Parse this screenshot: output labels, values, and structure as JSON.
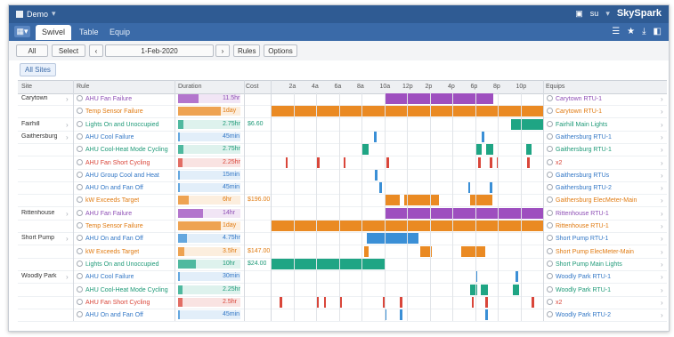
{
  "topbar": {
    "project": "Demo",
    "user": "su",
    "brand": "SkySpark"
  },
  "tabs": [
    {
      "label": "Swivel",
      "active": true
    },
    {
      "label": "Table",
      "active": false
    },
    {
      "label": "Equip",
      "active": false
    }
  ],
  "toolbar": {
    "all_sites": "All Sites",
    "select": "Select ▾",
    "prev": "‹",
    "date": "1-Feb-2020",
    "next": "›",
    "rules": "Rules",
    "options": "Options"
  },
  "filter_chip": "All Sites",
  "columns": {
    "site": "Site",
    "rule": "Rule",
    "duration": "Duration",
    "cost": "Cost",
    "equips": "Equips"
  },
  "time_ticks": [
    "2a",
    "4a",
    "6a",
    "8a",
    "10a",
    "12p",
    "2p",
    "4p",
    "6p",
    "8p",
    "10p"
  ],
  "colors": {
    "purple": "#9e4fbf",
    "orange": "#ea8a23",
    "teal": "#1fa584",
    "blue": "#3a8fd6",
    "red": "#d9463a",
    "topbar": "#2f5b93"
  },
  "rows": [
    {
      "site": "Carytown",
      "rule": "AHU Fan Failure",
      "rule_color": "#8e4fb5",
      "dur": "11.5hr",
      "dur_frac": 0.48,
      "cost": "",
      "equip": "Carytown RTU-1",
      "equip_color": "#8e4fb5",
      "bar_color": "#9e4fbf",
      "segments": [
        [
          10.0,
          19.6
        ]
      ],
      "has_arrow": true
    },
    {
      "site": "",
      "rule": "Temp Sensor Failure",
      "rule_color": "#e07b12",
      "dur": "1day",
      "dur_frac": 1.0,
      "cost": "",
      "equip": "Carytown RTU-1",
      "equip_color": "#e07b12",
      "bar_color": "#ea8a23",
      "segments": [
        [
          0,
          24
        ]
      ],
      "has_arrow": false
    },
    {
      "site": "Fairhill",
      "rule": "Lights On and Unoccupied",
      "rule_color": "#1f9a78",
      "dur": "2.75hr",
      "dur_frac": 0.12,
      "cost": "$6.60",
      "equip": "Fairhill Main Lights",
      "equip_color": "#1f9a78",
      "bar_color": "#1fa584",
      "segments": [
        [
          21.2,
          24
        ]
      ],
      "has_arrow": true
    },
    {
      "site": "Gaithersburg",
      "rule": "AHU Cool Failure",
      "rule_color": "#3478c6",
      "dur": "45min",
      "dur_frac": 0.04,
      "cost": "",
      "equip": "Gaithersburg RTU-1",
      "equip_color": "#3478c6",
      "bar_color": "#3a8fd6",
      "segments": [
        [
          9.1,
          9.35
        ],
        [
          18.6,
          18.85
        ]
      ],
      "has_arrow": true
    },
    {
      "site": "",
      "rule": "AHU Cool-Heat Mode Cycling",
      "rule_color": "#1f9a78",
      "dur": "2.75hr",
      "dur_frac": 0.12,
      "cost": "",
      "equip": "Gaithersburg RTU-1",
      "equip_color": "#1f9a78",
      "bar_color": "#1fa584",
      "segments": [
        [
          8.0,
          8.6
        ],
        [
          18.0,
          18.6
        ],
        [
          19.0,
          19.6
        ],
        [
          22.5,
          23.0
        ]
      ],
      "has_arrow": true
    },
    {
      "site": "",
      "rule": "AHU Fan Short Cycling",
      "rule_color": "#d9463a",
      "dur": "2.25hr",
      "dur_frac": 0.1,
      "cost": "",
      "equip": "x2",
      "equip_color": "#d9463a",
      "bar_color": "#d9463a",
      "segments": [
        [
          1.3,
          1.5
        ],
        [
          4.1,
          4.3
        ],
        [
          6.4,
          6.6
        ],
        [
          10.2,
          10.4
        ],
        [
          18.3,
          18.5
        ],
        [
          19.3,
          19.5
        ],
        [
          19.9,
          20.1
        ],
        [
          22.6,
          22.8
        ]
      ],
      "has_arrow": true
    },
    {
      "site": "",
      "rule": "AHU Group Cool and Heat",
      "rule_color": "#3478c6",
      "dur": "15min",
      "dur_frac": 0.02,
      "cost": "",
      "equip": "Gaithersburg RTUs",
      "equip_color": "#3478c6",
      "bar_color": "#3a8fd6",
      "segments": [
        [
          9.2,
          9.4
        ]
      ],
      "has_arrow": true
    },
    {
      "site": "",
      "rule": "AHU On and Fan Off",
      "rule_color": "#3478c6",
      "dur": "45min",
      "dur_frac": 0.04,
      "cost": "",
      "equip": "Gaithersburg RTU-2",
      "equip_color": "#3478c6",
      "bar_color": "#3a8fd6",
      "segments": [
        [
          9.6,
          9.8
        ],
        [
          17.4,
          17.6
        ],
        [
          19.3,
          19.5
        ]
      ],
      "has_arrow": true
    },
    {
      "site": "",
      "rule": "kW Exceeds Target",
      "rule_color": "#e07b12",
      "dur": "6hr",
      "dur_frac": 0.26,
      "cost": "$196.00",
      "equip": "Gaithersburg ElecMeter-Main",
      "equip_color": "#e07b12",
      "bar_color": "#ea8a23",
      "segments": [
        [
          10.0,
          11.4
        ],
        [
          11.8,
          14.8
        ],
        [
          17.6,
          19.5
        ]
      ],
      "has_arrow": true
    },
    {
      "site": "Rittenhouse",
      "rule": "AHU Fan Failure",
      "rule_color": "#8e4fb5",
      "dur": "14hr",
      "dur_frac": 0.58,
      "cost": "",
      "equip": "Rittenhouse RTU-1",
      "equip_color": "#8e4fb5",
      "bar_color": "#9e4fbf",
      "segments": [
        [
          10.0,
          24
        ]
      ],
      "has_arrow": true
    },
    {
      "site": "",
      "rule": "Temp Sensor Failure",
      "rule_color": "#e07b12",
      "dur": "1day",
      "dur_frac": 1.0,
      "cost": "",
      "equip": "Rittenhouse RTU-1",
      "equip_color": "#e07b12",
      "bar_color": "#ea8a23",
      "segments": [
        [
          0,
          24
        ]
      ],
      "has_arrow": false
    },
    {
      "site": "Short Pump",
      "rule": "AHU On and Fan Off",
      "rule_color": "#3478c6",
      "dur": "4.75hr",
      "dur_frac": 0.2,
      "cost": "",
      "equip": "Short Pump RTU-1",
      "equip_color": "#3478c6",
      "bar_color": "#3a8fd6",
      "segments": [
        [
          8.5,
          13.0
        ]
      ],
      "has_arrow": true
    },
    {
      "site": "",
      "rule": "kW Exceeds Target",
      "rule_color": "#e07b12",
      "dur": "3.5hr",
      "dur_frac": 0.15,
      "cost": "$147.00",
      "equip": "Short Pump ElecMeter-Main",
      "equip_color": "#e07b12",
      "bar_color": "#ea8a23",
      "segments": [
        [
          8.2,
          8.6
        ],
        [
          13.2,
          14.2
        ],
        [
          16.8,
          18.9
        ]
      ],
      "has_arrow": true
    },
    {
      "site": "",
      "rule": "Lights On and Unoccupied",
      "rule_color": "#1f9a78",
      "dur": "10hr",
      "dur_frac": 0.42,
      "cost": "$24.00",
      "equip": "Short Pump Main Lights",
      "equip_color": "#1f9a78",
      "bar_color": "#1fa584",
      "segments": [
        [
          0,
          10.0
        ]
      ],
      "has_arrow": true
    },
    {
      "site": "Woodly Park",
      "rule": "AHU Cool Failure",
      "rule_color": "#3478c6",
      "dur": "30min",
      "dur_frac": 0.03,
      "cost": "",
      "equip": "Woodly Park RTU-1",
      "equip_color": "#3478c6",
      "bar_color": "#3a8fd6",
      "segments": [
        [
          18.0,
          18.2
        ],
        [
          21.6,
          21.8
        ]
      ],
      "has_arrow": true
    },
    {
      "site": "",
      "rule": "AHU Cool-Heat Mode Cycling",
      "rule_color": "#1f9a78",
      "dur": "2.25hr",
      "dur_frac": 0.1,
      "cost": "",
      "equip": "Woodly Park RTU-1",
      "equip_color": "#1f9a78",
      "bar_color": "#1fa584",
      "segments": [
        [
          17.6,
          18.2
        ],
        [
          18.5,
          19.1
        ],
        [
          21.3,
          21.9
        ]
      ],
      "has_arrow": true
    },
    {
      "site": "",
      "rule": "AHU Fan Short Cycling",
      "rule_color": "#d9463a",
      "dur": "2.5hr",
      "dur_frac": 0.11,
      "cost": "",
      "equip": "x2",
      "equip_color": "#d9463a",
      "bar_color": "#d9463a",
      "segments": [
        [
          0.8,
          1.0
        ],
        [
          4.0,
          4.2
        ],
        [
          4.7,
          4.9
        ],
        [
          6.1,
          6.3
        ],
        [
          9.9,
          10.1
        ],
        [
          11.4,
          11.6
        ],
        [
          17.7,
          17.9
        ],
        [
          18.9,
          19.1
        ],
        [
          23.0,
          23.2
        ]
      ],
      "has_arrow": true
    },
    {
      "site": "",
      "rule": "AHU On and Fan Off",
      "rule_color": "#3478c6",
      "dur": "45min",
      "dur_frac": 0.04,
      "cost": "",
      "equip": "Woodly Park RTU-2",
      "equip_color": "#3478c6",
      "bar_color": "#3a8fd6",
      "segments": [
        [
          10.0,
          10.2
        ],
        [
          11.4,
          11.6
        ],
        [
          18.9,
          19.1
        ]
      ],
      "has_arrow": true
    }
  ]
}
